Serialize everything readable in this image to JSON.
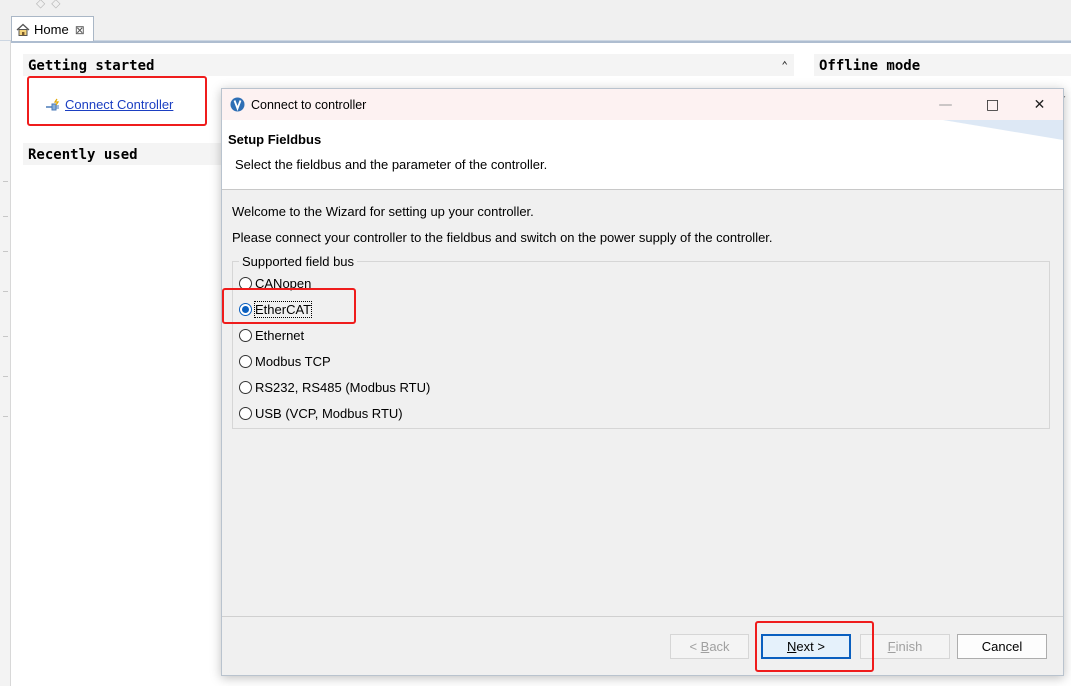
{
  "app": {
    "home_tab": {
      "label": "Home",
      "close_glyph": "⊠",
      "icon": "home-icon"
    },
    "getting_started": {
      "title": "Getting started",
      "collapse_glyph": "⌃",
      "connect_link": "Connect Controller"
    },
    "recently_used": {
      "title": "Recently used"
    },
    "offline_mode": {
      "title": "Offline mode",
      "clipped_text": "Y"
    }
  },
  "dialog": {
    "title": "Connect to controller",
    "window_controls": {
      "minimize": "—",
      "maximize": "□",
      "close": "✕"
    },
    "header": {
      "title": "Setup Fieldbus",
      "description": "Select the fieldbus and the parameter of the controller."
    },
    "welcome_text": "Welcome to the Wizard for setting up your controller.",
    "instruction_text": "Please connect your controller to the fieldbus and switch on the power supply of the controller.",
    "fieldbus_group": {
      "legend": "Supported field bus",
      "options": [
        {
          "label": "CANopen",
          "selected": false
        },
        {
          "label": "EtherCAT",
          "selected": true
        },
        {
          "label": "Ethernet",
          "selected": false
        },
        {
          "label": "Modbus TCP",
          "selected": false
        },
        {
          "label": "RS232, RS485 (Modbus RTU)",
          "selected": false
        },
        {
          "label": "USB (VCP, Modbus RTU)",
          "selected": false
        }
      ]
    },
    "buttons": {
      "back": {
        "prefix": "< ",
        "mnemonic": "B",
        "rest": "ack",
        "enabled": false
      },
      "next": {
        "mnemonic": "N",
        "rest": "ext >",
        "enabled": true
      },
      "finish": {
        "mnemonic": "F",
        "rest": "inish",
        "enabled": false
      },
      "cancel": {
        "label": "Cancel",
        "enabled": true
      }
    }
  },
  "colors": {
    "highlight": "#ef1c1c",
    "accent": "#0a5fbf",
    "link": "#1b3fc2"
  }
}
